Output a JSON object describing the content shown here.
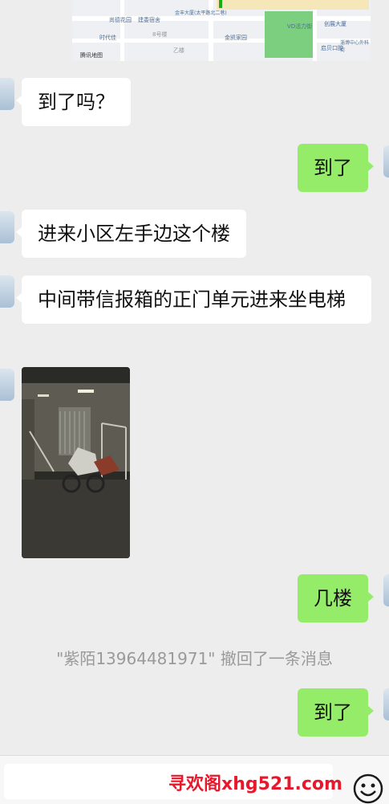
{
  "map": {
    "labels": [
      "尚德花园",
      "建委宿舍",
      "金丰大厦(太平路北二巷)",
      "创展大厦",
      "时代佳",
      "8号楼",
      "金凯家园",
      "VD活力街",
      "淄博中心外科街",
      "乙楼",
      "启贝口腔",
      "腾讯地图"
    ]
  },
  "messages": [
    {
      "side": "in",
      "text": "到了吗？"
    },
    {
      "side": "out",
      "text": "到了"
    },
    {
      "side": "in",
      "text": "进来小区左手边这个楼"
    },
    {
      "side": "in",
      "text": "中间带信报箱的正门单元进来坐电梯"
    },
    {
      "side": "in",
      "kind": "image",
      "alt": "stairwell photo"
    },
    {
      "side": "out",
      "text": "几楼"
    },
    {
      "side": "out",
      "text": "到了"
    }
  ],
  "system_notice": "\"紫陌13964481971\" 撤回了一条消息",
  "input_bar": {
    "watermark": "寻欢阁xhg521.com",
    "emoji_icon": "smiley-face-icon"
  },
  "colors": {
    "out_bubble": "#95ec69",
    "in_bubble": "#ffffff",
    "background": "#ededed"
  }
}
